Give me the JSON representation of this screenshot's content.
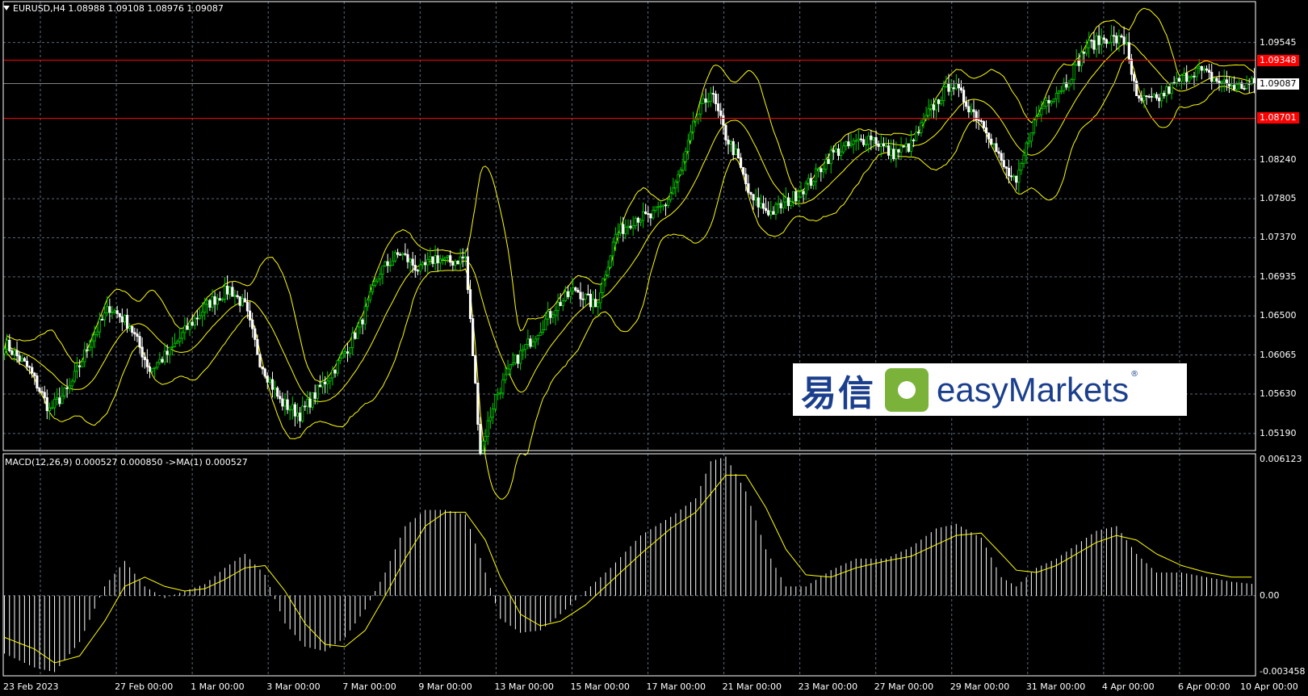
{
  "header": {
    "title": "EURUSD,H4  1.08988 1.09108 1.08976 1.09087"
  },
  "macd_panel": {
    "title": "MACD(12,26,9) 0.000527 0.000850  ->MA(1) 0.000527"
  },
  "watermark": {
    "cn": "易信",
    "en": "easyMarkets",
    "reg": "®"
  },
  "colors": {
    "background": "#000000",
    "grid": "#5a6a7a",
    "bull_candle": "#00d000",
    "bear_candle": "#ffffff",
    "bands": "#ffff00",
    "level_line": "#ff0000",
    "price_line": "#808080",
    "macd_hist": "#ffffff",
    "macd_signal": "#ffff00"
  },
  "chart_data": [
    {
      "type": "candlestick",
      "symbol": "EURUSD",
      "timeframe": "H4",
      "ohlc_header": {
        "open": 1.08988,
        "high": 1.09108,
        "low": 1.08976,
        "close": 1.09087
      },
      "ylim": [
        1.05,
        1.1
      ],
      "y_ticks": [
        "1.09545",
        "1.08240",
        "1.07805",
        "1.07370",
        "1.06935",
        "1.06500",
        "1.06065",
        "1.05630",
        "1.05190"
      ],
      "x_ticks": [
        "23 Feb 2023",
        "27 Feb 00:00",
        "1 Mar 00:00",
        "3 Mar 00:00",
        "7 Mar 00:00",
        "9 Mar 00:00",
        "13 Mar 00:00",
        "15 Mar 00:00",
        "17 Mar 00:00",
        "21 Mar 00:00",
        "23 Mar 00:00",
        "27 Mar 00:00",
        "29 Mar 00:00",
        "31 Mar 00:00",
        "4 Apr 00:00",
        "6 Apr 00:00",
        "10 Apr 00:00"
      ],
      "horizontal_levels": [
        {
          "label": "1.09348",
          "value": 1.09348,
          "kind": "level"
        },
        {
          "label": "1.09087",
          "value": 1.09087,
          "kind": "current"
        },
        {
          "label": "1.08701",
          "value": 1.08701,
          "kind": "level"
        }
      ],
      "close_path": [
        [
          0,
          1.062
        ],
        [
          10,
          1.059
        ],
        [
          18,
          1.0545
        ],
        [
          26,
          1.057
        ],
        [
          34,
          1.062
        ],
        [
          42,
          1.066
        ],
        [
          50,
          1.064
        ],
        [
          58,
          1.059
        ],
        [
          66,
          1.061
        ],
        [
          74,
          1.064
        ],
        [
          82,
          1.0665
        ],
        [
          90,
          1.068
        ],
        [
          96,
          1.066
        ],
        [
          102,
          1.06
        ],
        [
          110,
          1.0555
        ],
        [
          118,
          1.054
        ],
        [
          126,
          1.057
        ],
        [
          134,
          1.06
        ],
        [
          142,
          1.064
        ],
        [
          150,
          1.07
        ],
        [
          158,
          1.072
        ],
        [
          166,
          1.07
        ],
        [
          172,
          1.0715
        ],
        [
          178,
          1.071
        ],
        [
          184,
          1.0715
        ],
        [
          190,
          1.05
        ],
        [
          196,
          1.056
        ],
        [
          204,
          1.06
        ],
        [
          212,
          1.063
        ],
        [
          220,
          1.066
        ],
        [
          228,
          1.068
        ],
        [
          236,
          1.066
        ],
        [
          244,
          1.074
        ],
        [
          252,
          1.076
        ],
        [
          258,
          1.076
        ],
        [
          264,
          1.0775
        ],
        [
          270,
          1.081
        ],
        [
          276,
          1.087
        ],
        [
          282,
          1.09
        ],
        [
          288,
          1.085
        ],
        [
          292,
          1.083
        ],
        [
          298,
          1.078
        ],
        [
          306,
          1.0765
        ],
        [
          314,
          1.078
        ],
        [
          322,
          1.08
        ],
        [
          330,
          1.083
        ],
        [
          338,
          1.084
        ],
        [
          346,
          1.085
        ],
        [
          354,
          1.083
        ],
        [
          362,
          1.084
        ],
        [
          370,
          1.088
        ],
        [
          378,
          1.091
        ],
        [
          386,
          1.088
        ],
        [
          392,
          1.086
        ],
        [
          398,
          1.082
        ],
        [
          404,
          1.0795
        ],
        [
          410,
          1.086
        ],
        [
          416,
          1.089
        ],
        [
          424,
          1.091
        ],
        [
          432,
          1.095
        ],
        [
          440,
          1.096
        ],
        [
          448,
          1.0955
        ],
        [
          452,
          1.089
        ],
        [
          460,
          1.089
        ],
        [
          468,
          1.091
        ],
        [
          476,
          1.0925
        ],
        [
          484,
          1.0912
        ],
        [
          492,
          1.0905
        ],
        [
          499,
          1.0909
        ]
      ]
    },
    {
      "type": "line",
      "title": "MACD(12,26,9) 0.000527 0.000850  ->MA(1) 0.000527",
      "ylim": [
        -0.003458,
        0.006123
      ],
      "y_ticks": [
        "0.006123",
        "0.00",
        "-0.003458"
      ],
      "series": [
        {
          "values": [
            [
              0,
              -0.0025
            ],
            [
              12,
              -0.0031
            ],
            [
              20,
              -0.0033
            ],
            [
              30,
              -0.002
            ],
            [
              40,
              0.0004
            ],
            [
              48,
              0.0015
            ],
            [
              56,
              0.0004
            ],
            [
              64,
              -0.0001
            ],
            [
              72,
              0.0002
            ],
            [
              80,
              0.0005
            ],
            [
              88,
              0.0012
            ],
            [
              96,
              0.0018
            ],
            [
              104,
              0.0009
            ],
            [
              112,
              -0.0012
            ],
            [
              120,
              -0.0022
            ],
            [
              128,
              -0.0024
            ],
            [
              136,
              -0.0018
            ],
            [
              144,
              -0.0006
            ],
            [
              152,
              0.001
            ],
            [
              160,
              0.003
            ],
            [
              168,
              0.0037
            ],
            [
              176,
              0.0037
            ],
            [
              184,
              0.0035
            ],
            [
              192,
              0.001
            ],
            [
              198,
              -0.001
            ],
            [
              206,
              -0.0016
            ],
            [
              214,
              -0.0015
            ],
            [
              222,
              -0.0008
            ],
            [
              232,
              0.0002
            ],
            [
              242,
              0.0012
            ],
            [
              254,
              0.0026
            ],
            [
              266,
              0.0034
            ],
            [
              276,
              0.0042
            ],
            [
              282,
              0.0058
            ],
            [
              288,
              0.006
            ],
            [
              296,
              0.0045
            ],
            [
              304,
              0.002
            ],
            [
              312,
              0.0004
            ],
            [
              320,
              0.0004
            ],
            [
              330,
              0.0011
            ],
            [
              340,
              0.0016
            ],
            [
              352,
              0.0016
            ],
            [
              362,
              0.0021
            ],
            [
              372,
              0.0029
            ],
            [
              380,
              0.0031
            ],
            [
              390,
              0.0025
            ],
            [
              398,
              0.0008
            ],
            [
              404,
              0.0004
            ],
            [
              412,
              0.0012
            ],
            [
              420,
              0.0016
            ],
            [
              428,
              0.0022
            ],
            [
              436,
              0.0028
            ],
            [
              444,
              0.003
            ],
            [
              452,
              0.0018
            ],
            [
              460,
              0.001
            ],
            [
              470,
              0.001
            ],
            [
              480,
              0.0008
            ],
            [
              490,
              0.0006
            ],
            [
              499,
              0.0005
            ]
          ]
        },
        {
          "values": [
            [
              0,
              -0.0018
            ],
            [
              12,
              -0.0023
            ],
            [
              20,
              -0.0029
            ],
            [
              30,
              -0.0026
            ],
            [
              40,
              -0.0011
            ],
            [
              48,
              0.0004
            ],
            [
              56,
              0.0008
            ],
            [
              64,
              0.0004
            ],
            [
              72,
              0.0002
            ],
            [
              80,
              0.0003
            ],
            [
              88,
              0.0007
            ],
            [
              96,
              0.0012
            ],
            [
              104,
              0.0013
            ],
            [
              112,
              0.0002
            ],
            [
              120,
              -0.0012
            ],
            [
              128,
              -0.0021
            ],
            [
              136,
              -0.0022
            ],
            [
              144,
              -0.0015
            ],
            [
              152,
              0.0
            ],
            [
              160,
              0.0016
            ],
            [
              168,
              0.003
            ],
            [
              176,
              0.0036
            ],
            [
              184,
              0.0036
            ],
            [
              192,
              0.0024
            ],
            [
              198,
              0.0008
            ],
            [
              206,
              -0.0008
            ],
            [
              214,
              -0.0013
            ],
            [
              222,
              -0.0011
            ],
            [
              232,
              -0.0004
            ],
            [
              242,
              0.0006
            ],
            [
              254,
              0.0018
            ],
            [
              266,
              0.0029
            ],
            [
              276,
              0.0036
            ],
            [
              282,
              0.0044
            ],
            [
              288,
              0.0052
            ],
            [
              296,
              0.0052
            ],
            [
              304,
              0.0038
            ],
            [
              312,
              0.002
            ],
            [
              320,
              0.0009
            ],
            [
              330,
              0.0008
            ],
            [
              340,
              0.0012
            ],
            [
              352,
              0.0015
            ],
            [
              362,
              0.0017
            ],
            [
              372,
              0.0022
            ],
            [
              380,
              0.0026
            ],
            [
              390,
              0.0027
            ],
            [
              398,
              0.0018
            ],
            [
              404,
              0.0011
            ],
            [
              412,
              0.001
            ],
            [
              420,
              0.0013
            ],
            [
              428,
              0.0018
            ],
            [
              436,
              0.0023
            ],
            [
              444,
              0.0026
            ],
            [
              452,
              0.0024
            ],
            [
              460,
              0.0018
            ],
            [
              470,
              0.0013
            ],
            [
              480,
              0.001
            ],
            [
              490,
              0.0008
            ],
            [
              499,
              0.0008
            ]
          ]
        }
      ]
    }
  ]
}
